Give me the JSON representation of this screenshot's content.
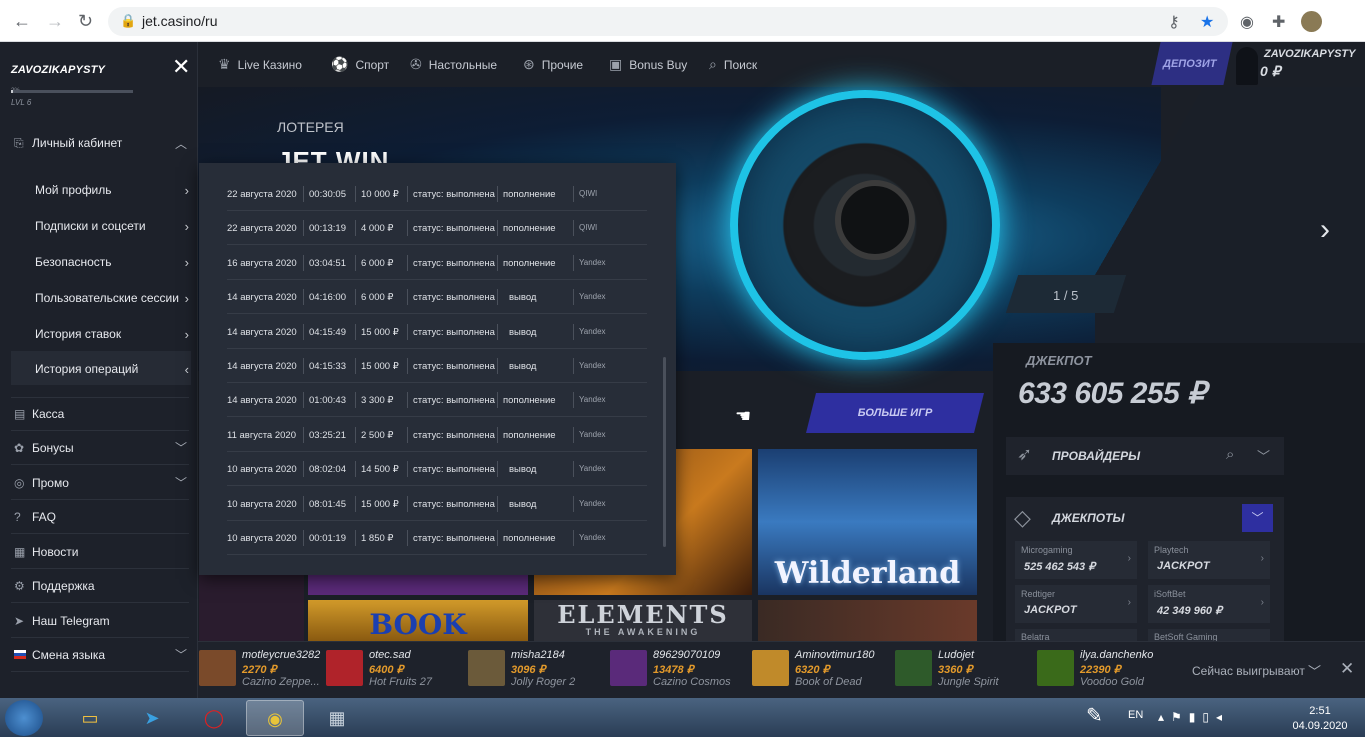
{
  "browser": {
    "url": "jet.casino/ru"
  },
  "sidebar": {
    "username": "ZAVOZIKAPYSTY",
    "progress_pct_text": "2%",
    "progress": 0.02,
    "level": "LVL 6",
    "account_label": "Личный кабинет",
    "sub": [
      {
        "label": "Мой профиль"
      },
      {
        "label": "Подписки и соцсети"
      },
      {
        "label": "Безопасность"
      },
      {
        "label": "Пользовательские сессии"
      },
      {
        "label": "История ставок"
      },
      {
        "label": "История операций"
      }
    ],
    "items": [
      {
        "label": "Касса"
      },
      {
        "label": "Бонусы"
      },
      {
        "label": "Промо"
      },
      {
        "label": "FAQ"
      },
      {
        "label": "Новости"
      },
      {
        "label": "Поддержка"
      },
      {
        "label": "Наш Telegram"
      },
      {
        "label": "Смена языка"
      }
    ]
  },
  "topnav": {
    "items": [
      "Live Казино",
      "Спорт",
      "Настольные",
      "Прочие",
      "Bonus Buy",
      "Поиск"
    ],
    "deposit": "ДЕПОЗИТ",
    "user": "ZAVOZIKAPYSTY",
    "balance": "0 ₽"
  },
  "banner": {
    "kicker": "ЛОТЕРЕЯ",
    "title": "JET WIN",
    "counter": "1 / 5"
  },
  "more_games": "БОЛЬШЕ ИГР",
  "jackpot": {
    "label": "ДЖЕКПОТ",
    "amount": "633 605 255 ₽"
  },
  "providers": {
    "label": "ПРОВАЙДЕРЫ"
  },
  "jackpots": {
    "label": "ДЖЕКПОТЫ",
    "cells": [
      {
        "name": "Microgaming",
        "value": "525 462 543 ₽"
      },
      {
        "name": "Playtech",
        "value": "JACKPOT"
      },
      {
        "name": "Redtiger",
        "value": "JACKPOT"
      },
      {
        "name": "iSoftBet",
        "value": "42 349 960 ₽"
      },
      {
        "name": "Belatra",
        "value": ""
      },
      {
        "name": "BetSoft Gaming",
        "value": ""
      }
    ]
  },
  "history": {
    "rows": [
      {
        "date": "22 августа 2020",
        "time": "00:30:05",
        "amount": "10 000 ₽",
        "status": "статус: выполнена",
        "type": "пополнение",
        "method": "QIWI"
      },
      {
        "date": "22 августа 2020",
        "time": "00:13:19",
        "amount": "4 000 ₽",
        "status": "статус: выполнена",
        "type": "пополнение",
        "method": "QIWI"
      },
      {
        "date": "16 августа 2020",
        "time": "03:04:51",
        "amount": "6 000 ₽",
        "status": "статус: выполнена",
        "type": "пополнение",
        "method": "Yandex"
      },
      {
        "date": "14 августа 2020",
        "time": "04:16:00",
        "amount": "6 000 ₽",
        "status": "статус: выполнена",
        "type": "вывод",
        "method": "Yandex"
      },
      {
        "date": "14 августа 2020",
        "time": "04:15:49",
        "amount": "15 000 ₽",
        "status": "статус: выполнена",
        "type": "вывод",
        "method": "Yandex"
      },
      {
        "date": "14 августа 2020",
        "time": "04:15:33",
        "amount": "15 000 ₽",
        "status": "статус: выполнена",
        "type": "вывод",
        "method": "Yandex"
      },
      {
        "date": "14 августа 2020",
        "time": "01:00:43",
        "amount": "3 300 ₽",
        "status": "статус: выполнена",
        "type": "пополнение",
        "method": "Yandex"
      },
      {
        "date": "11 августа 2020",
        "time": "03:25:21",
        "amount": "2 500 ₽",
        "status": "статус: выполнена",
        "type": "пополнение",
        "method": "Yandex"
      },
      {
        "date": "10 августа 2020",
        "time": "08:02:04",
        "amount": "14 500 ₽",
        "status": "статус: выполнена",
        "type": "вывод",
        "method": "Yandex"
      },
      {
        "date": "10 августа 2020",
        "time": "08:01:45",
        "amount": "15 000 ₽",
        "status": "статус: выполнена",
        "type": "вывод",
        "method": "Yandex"
      },
      {
        "date": "10 августа 2020",
        "time": "00:01:19",
        "amount": "1 850 ₽",
        "status": "статус: выполнена",
        "type": "пополнение",
        "method": "Yandex"
      }
    ]
  },
  "tiles": {
    "wilderland": "Wilderland",
    "book": "BOOK",
    "elements": "ELEMENTS",
    "elements_sub": "THE AWAKENING"
  },
  "ticker": {
    "winners": [
      {
        "user": "motleycrue3282",
        "sum": "2270 ₽",
        "game": "Cazino Zeppe...",
        "color": "#7a4a2a"
      },
      {
        "user": "otec.sad",
        "sum": "6400 ₽",
        "game": "Hot Fruits 27",
        "color": "#b0232a"
      },
      {
        "user": "misha2184",
        "sum": "3096 ₽",
        "game": "Jolly Roger 2",
        "color": "#6b5a3a"
      },
      {
        "user": "89629070109",
        "sum": "13478 ₽",
        "game": "Cazino Cosmos",
        "color": "#5a2a7a"
      },
      {
        "user": "Aminovtimur180",
        "sum": "6320 ₽",
        "game": "Book of Dead",
        "color": "#c08a2a"
      },
      {
        "user": "Ludojet",
        "sum": "3360 ₽",
        "game": "Jungle Spirit",
        "color": "#2e5a2a"
      },
      {
        "user": "ilya.danchenko",
        "sum": "22390 ₽",
        "game": "Voodoo Gold",
        "color": "#3a6a1a"
      }
    ],
    "label": "Сейчас выигрывают"
  },
  "taskbar": {
    "lang": "EN",
    "time": "2:51",
    "date": "04.09.2020"
  }
}
